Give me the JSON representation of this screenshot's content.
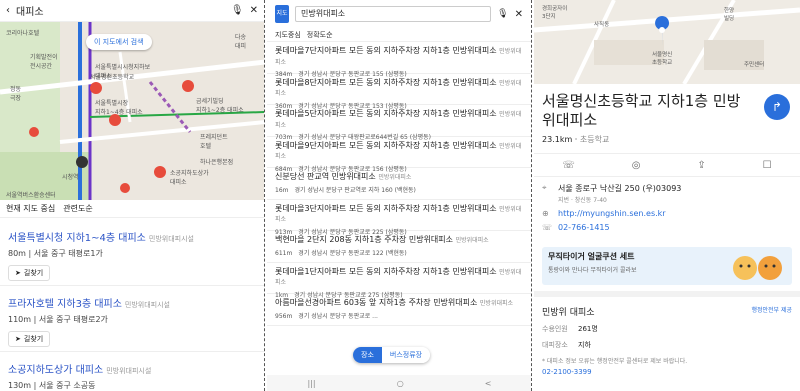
{
  "panel1": {
    "search": "대피소",
    "map_labels": {
      "corr": "코리아나호텔",
      "gov": "기획발전이\n전시공간",
      "school": "서울명신초등학교",
      "seoul_hall": "서울시청",
      "plaza": "서울특별시장\n지하1~4층 대피소",
      "pass": "서울특별시시청지하보\n대피소",
      "kumsegi": "금세기빌딩\n지하1~2층 대피소",
      "dasong": "다송\n대피",
      "jeongdong": "정동\n극장",
      "press": "프레지던트\n호텔",
      "hanahall": "하나은행본점",
      "line_sogong": "소공지하도상가\n대피소",
      "station": "시청역",
      "bus": "서울역버스환승센터",
      "mapbtn": "이 지도에서 검색"
    },
    "filter_scope": "현재 지도 중심",
    "filter_sort": "관련도순",
    "results": [
      {
        "title": "서울특별시청 지하1~4층 대피소",
        "cat": "민방위대피시설",
        "dist": "80m",
        "addr": "서울 중구 태평로1가",
        "btn": "길찾기"
      },
      {
        "title": "프라자호텔 지하3층 대피소",
        "cat": "민방위대피시설",
        "dist": "110m",
        "addr": "서울 중구 태평로2가",
        "btn": "길찾기"
      },
      {
        "title": "소공지하도상가 대피소",
        "cat": "민방위대피시설",
        "dist": "130m",
        "addr": "서울 중구 소공동",
        "btn": ""
      }
    ]
  },
  "panel2": {
    "logo": "지도",
    "search": "민방위대피소",
    "filter_a": "지도중심",
    "filter_b": "정확도순",
    "items": [
      {
        "name": "롯데마을7단지아파트 모든 동의 지하주차장 지하1층 민방위대피소",
        "cat": "민방위대피소",
        "dist": "384m",
        "addr": "경기 성남시 분당구 동판교로 155 (삼평동)"
      },
      {
        "name": "롯데마을8단지아파트 모든 동의 지하주차장 지하1층 민방위대피소",
        "cat": "민방위대피소",
        "dist": "360m",
        "addr": "경기 성남시 분당구 동판교로 153 (삼평동)"
      },
      {
        "name": "롯데마을5단지아파트 모든 동의 지하주차장 지하1층 민방위대피소",
        "cat": "민방위대피소",
        "dist": "703m",
        "addr": "경기 성남시 분당구 대왕판교로644번길 65 (삼평동)"
      },
      {
        "name": "롯데마을9단지아파트 모든 동의 지하주차장 지하1층 민방위대피소",
        "cat": "민방위대피소",
        "dist": "684m",
        "addr": "경기 성남시 분당구 동판교로 156 (삼평동)"
      },
      {
        "name": "신분당선 판교역 민방위대피소",
        "cat": "민방위대피소",
        "dist": "16m",
        "addr": "경기 성남시 분당구 판교역로 지하 160 (백현동)"
      },
      {
        "name": "롯데마을3단지아파트 모든 동의 지하주차장 지하1층 민방위대피소",
        "cat": "민방위대피소",
        "dist": "913m",
        "addr": "경기 성남시 분당구 동판교로 225 (삼평동)"
      },
      {
        "name": "백현마을 2단지 208동 지하1층 주차장 민방위대피소",
        "cat": "민방위대피소",
        "dist": "611m",
        "addr": "경기 성남시 분당구 동판교로 122 (백현동)"
      },
      {
        "name": "롯데마을1단지아파트 모든 동의 지하주차장 지하1층 민방위대피소",
        "cat": "민방위대피소",
        "dist": "1km",
        "addr": "경기 성남시 분당구 동판교로 275 (삼평동)"
      },
      {
        "name": "아름마을선경아파트 603동 앞 지하1층 주차장 민방위대피소",
        "cat": "민방위대피소",
        "dist": "956m",
        "addr": "경기 성남시 분당구 동판교로 ..."
      }
    ],
    "tab_on": "장소",
    "tab_off": "버스정류장",
    "nav": [
      "|||",
      "○",
      "<"
    ]
  },
  "panel3": {
    "map_labels": {
      "a": "경희궁자이\n3단지",
      "b": "한양\n빌딩",
      "c": "서울명신\n초등학교",
      "d": "사직동",
      "e": "주민센터"
    },
    "title": "서울명신초등학교 지하1층 민방위대피소",
    "dist": "23.1km",
    "cat": "초등학교",
    "dir_icon": "↱",
    "addr": "서울 종로구 낙산길 250 (우)03093",
    "addr_sub": "지번 · 창신동 7-40",
    "url": "http://myungshin.sen.es.kr",
    "phone": "02-766-1415",
    "banner_title": "무직타이거 얼굴쿠션 세트",
    "banner_sub": "통랑이와 만나다 무직타이거 콜라보",
    "shelter_title": "민방위 대피소",
    "shelter_src": "행정안전부 제공",
    "k1": "수용인원",
    "v1": "261명",
    "k2": "대피장소",
    "v2": "지하",
    "note": "* 대피소 정보 오류는 행정안전부 콜센터로 제보 바랍니다.",
    "tel": "02-2100-3399"
  },
  "colors": {
    "accent": "#2a6fdb",
    "link": "#2a53c6"
  }
}
